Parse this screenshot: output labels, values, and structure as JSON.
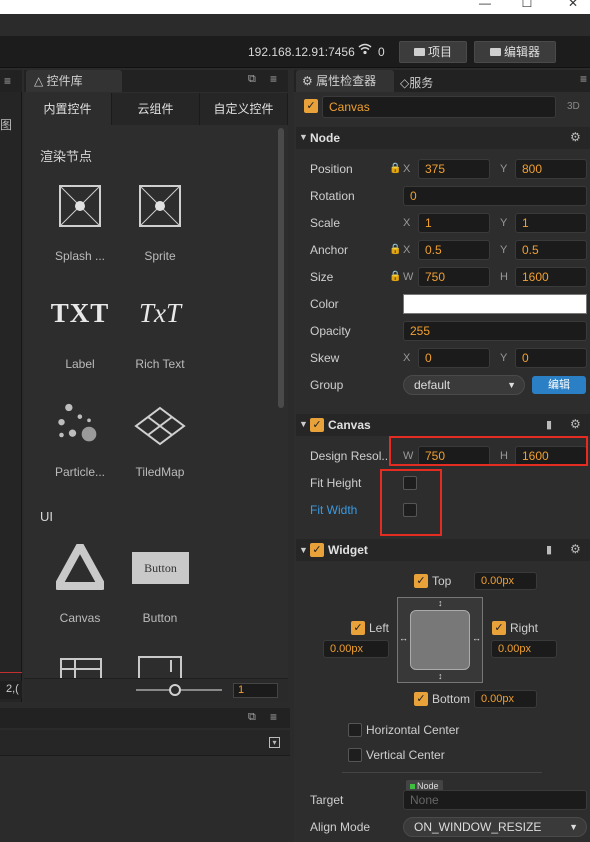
{
  "window": {
    "minimize_icon": "—",
    "maximize_icon": "☐",
    "close_icon": "✕"
  },
  "toolbar": {
    "ip": "192.168.12.91:7456",
    "connections": "0",
    "project_label": "项目",
    "editor_label": "编辑器"
  },
  "left_edge": {
    "label": "图",
    "coord": "2,("
  },
  "library": {
    "tab_label": "控件库",
    "tabs": [
      "内置控件",
      "云组件",
      "自定义控件"
    ],
    "section_render": "渲染节点",
    "section_ui": "UI",
    "items": [
      {
        "label": "Splash ...",
        "icon": "splash-icon"
      },
      {
        "label": "Sprite",
        "icon": "sprite-icon"
      },
      {
        "label": "Label",
        "icon": "label-icon",
        "glyph": "TXT"
      },
      {
        "label": "Rich Text",
        "icon": "richtext-icon",
        "glyph": "TxT"
      },
      {
        "label": "Particle...",
        "icon": "particle-icon"
      },
      {
        "label": "TiledMap",
        "icon": "tiledmap-icon"
      },
      {
        "label": "Canvas",
        "icon": "canvas-icon"
      },
      {
        "label": "Button",
        "icon": "button-icon",
        "glyph": "Button"
      }
    ],
    "zoom_value": "1"
  },
  "inspector": {
    "tab_label": "属性检查器",
    "service_tab": "服务",
    "node_name": "Canvas",
    "mode_3d": "3D",
    "node_section": "Node",
    "props": {
      "position": {
        "label": "Position",
        "x": "375",
        "y": "800"
      },
      "rotation": {
        "label": "Rotation",
        "value": "0"
      },
      "scale": {
        "label": "Scale",
        "x": "1",
        "y": "1"
      },
      "anchor": {
        "label": "Anchor",
        "x": "0.5",
        "y": "0.5"
      },
      "size": {
        "label": "Size",
        "w": "750",
        "h": "1600"
      },
      "color": {
        "label": "Color",
        "value": "#ffffff"
      },
      "opacity": {
        "label": "Opacity",
        "value": "255"
      },
      "skew": {
        "label": "Skew",
        "x": "0",
        "y": "0"
      },
      "group": {
        "label": "Group",
        "value": "default",
        "edit_button": "编辑"
      }
    },
    "axis_x": "X",
    "axis_y": "Y",
    "axis_w": "W",
    "axis_h": "H",
    "canvas_section": "Canvas",
    "canvas": {
      "design_label": "Design Resol...",
      "w": "750",
      "h": "1600",
      "fit_height_label": "Fit Height",
      "fit_width_label": "Fit Width"
    },
    "widget_section": "Widget",
    "widget": {
      "top_label": "Top",
      "top_value": "0.00px",
      "left_label": "Left",
      "left_value": "0.00px",
      "right_label": "Right",
      "right_value": "0.00px",
      "bottom_label": "Bottom",
      "bottom_value": "0.00px",
      "hcenter_label": "Horizontal Center",
      "vcenter_label": "Vertical Center",
      "target_label": "Target",
      "target_tag": "Node",
      "target_value": "None",
      "align_mode_label": "Align Mode",
      "align_mode_value": "ON_WINDOW_RESIZE"
    }
  },
  "colors": {
    "accent": "#e9a13a",
    "value_text": "#f0a030",
    "link_blue": "#3b9ae1",
    "highlight_red": "#e52c23",
    "edit_button": "#2b7fc4"
  }
}
